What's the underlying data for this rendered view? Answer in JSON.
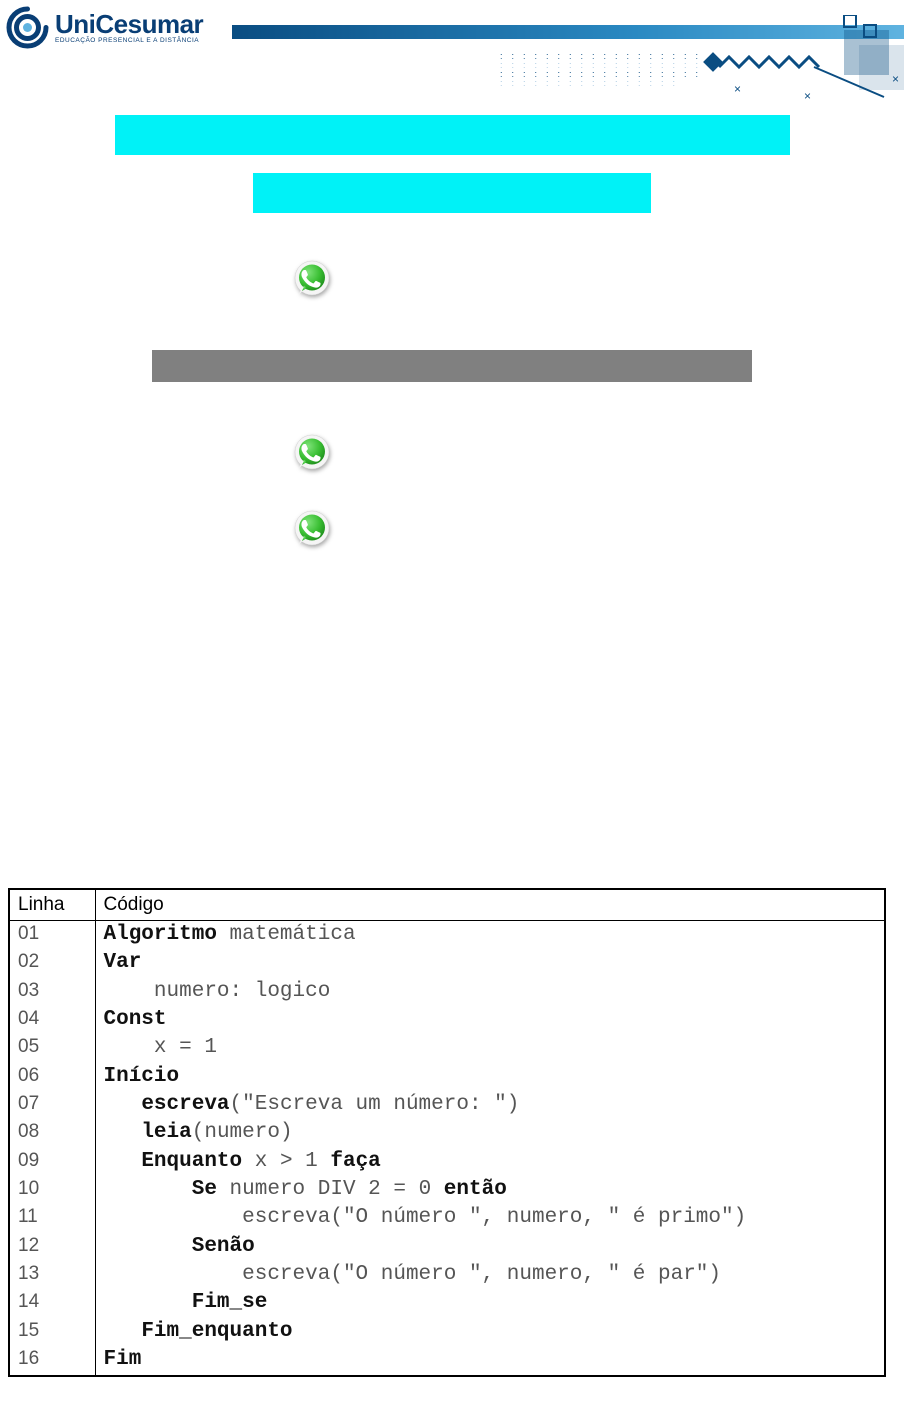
{
  "logo": {
    "brand": "UniCesumar",
    "tagline": "EDUCAÇÃO PRESENCIAL E A DISTÂNCIA"
  },
  "code_table": {
    "headers": {
      "linha": "Linha",
      "codigo": "Código"
    },
    "rows": [
      {
        "ln": "01",
        "kw1": "Algoritmo",
        "rest": " matemática"
      },
      {
        "ln": "02",
        "kw1": "Var",
        "rest": ""
      },
      {
        "ln": "03",
        "indent": "    ",
        "rest": "numero: logico"
      },
      {
        "ln": "04",
        "kw1": "Const",
        "rest": ""
      },
      {
        "ln": "05",
        "indent": "    ",
        "rest": "x = 1"
      },
      {
        "ln": "06",
        "kw1": "Início",
        "rest": ""
      },
      {
        "ln": "07",
        "indent": "   ",
        "kw1": "escreva",
        "rest": "(\"Escreva um número: \")"
      },
      {
        "ln": "08",
        "indent": "   ",
        "kw1": "leia",
        "rest": "(numero)"
      },
      {
        "ln": "09",
        "indent": "   ",
        "kw1": "Enquanto",
        "mid": " x > 1 ",
        "kw2": "faça"
      },
      {
        "ln": "10",
        "indent": "       ",
        "kw1": "Se",
        "mid": " numero DIV 2 = 0 ",
        "kw2": "então"
      },
      {
        "ln": "11",
        "indent": "           ",
        "rest": "escreva(\"O número \", numero, \" é primo\")"
      },
      {
        "ln": "12",
        "indent": "       ",
        "kw1": "Senão",
        "rest": ""
      },
      {
        "ln": "13",
        "indent": "           ",
        "rest": "escreva(\"O número \", numero, \" é par\")"
      },
      {
        "ln": "14",
        "indent": "       ",
        "kw1": "Fim_se",
        "rest": ""
      },
      {
        "ln": "15",
        "indent": "   ",
        "kw1": "Fim_enquanto",
        "rest": ""
      },
      {
        "ln": "16",
        "kw1": "Fim",
        "rest": ""
      }
    ]
  }
}
